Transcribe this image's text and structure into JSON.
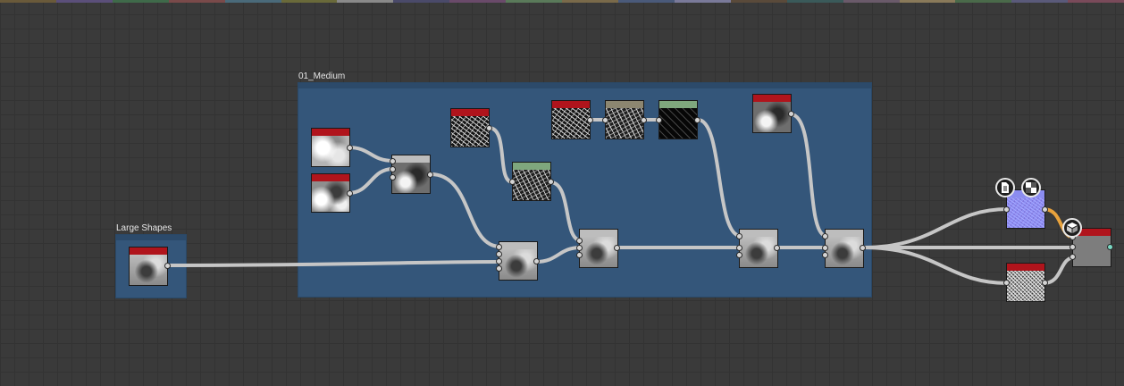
{
  "frames": {
    "large_shapes": {
      "title": "Large Shapes"
    },
    "medium": {
      "title": "01_Medium"
    }
  },
  "top_strip_colors": [
    "#6a5a3a",
    "#5b4f7a",
    "#3f6a4a",
    "#7a4a4a",
    "#4a6a7a",
    "#6a6a3a",
    "#8a8a8a",
    "#4a4a6a",
    "#6a4a6a",
    "#5a7a5a",
    "#7a6a4a",
    "#4a5a7a",
    "#7a7a9a",
    "#5a4a3a",
    "#3a5a5a",
    "#6a5a6a",
    "#8a7a5a",
    "#4a6a4a",
    "#5a5a7a",
    "#7a4a5a"
  ],
  "colors": {
    "frame": "#34567a",
    "link": "#c6c6c6",
    "link_highlight": "#e8a23c",
    "node_header_red": "#b0141c",
    "node_header_green": "#7fa77d",
    "node_header_tan": "#8c8670"
  },
  "icons": {
    "document": "document-icon",
    "checker": "checker-icon",
    "cube": "cube-icon"
  }
}
